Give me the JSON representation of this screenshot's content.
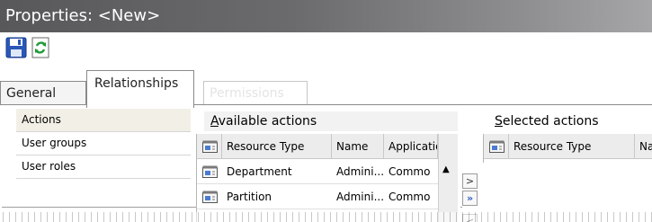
{
  "window": {
    "title": "Properties: <New>"
  },
  "toolbar": {
    "save_icon": "save-disk-icon",
    "refresh_icon": "refresh-icon"
  },
  "tabs": [
    {
      "label": "General"
    },
    {
      "label": "Relationships",
      "selected": true
    },
    {
      "label": "Permissions",
      "disabled": true
    }
  ],
  "nav": {
    "items": [
      {
        "label": "Actions",
        "selected": true
      },
      {
        "label": "User groups"
      },
      {
        "label": "User roles"
      }
    ]
  },
  "available": {
    "title_accesskey": "A",
    "title_rest": "vailable actions",
    "columns": [
      "Resource Type",
      "Name",
      "Application"
    ],
    "rows": [
      {
        "type": "Department",
        "name": "Admini...",
        "app": "Commo"
      },
      {
        "type": "Partition",
        "name": "Admini...",
        "app": "Commo"
      }
    ]
  },
  "selected": {
    "title_accesskey": "S",
    "title_rest": "elected actions",
    "columns": [
      "Resource Type",
      "Nam"
    ]
  },
  "movers": {
    "add": ">",
    "add_all": "»",
    "remove": "<"
  },
  "colors": {
    "title_bar": "#5f5f61",
    "nav_selected": "#f2f0e6",
    "add_all_accent": "#2f5fbf"
  }
}
